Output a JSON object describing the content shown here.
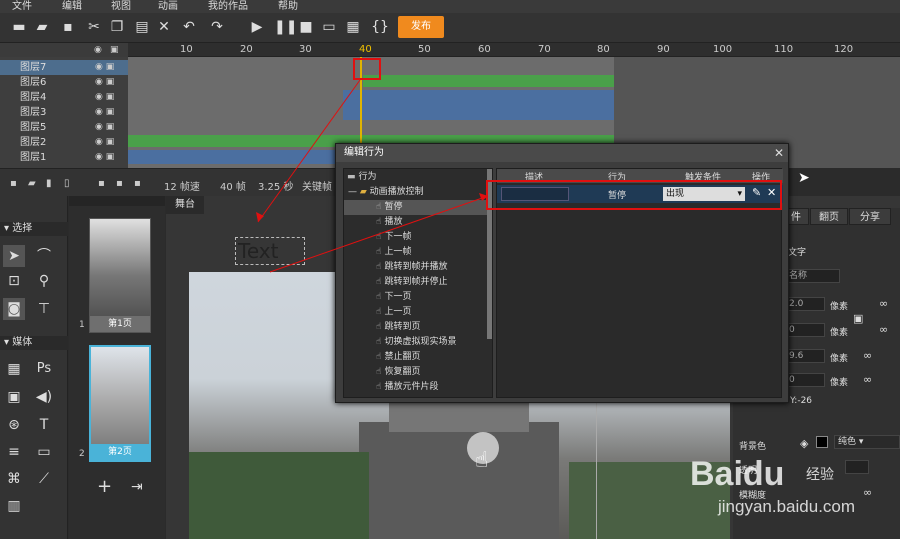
{
  "menu": [
    "文件",
    "编辑",
    "视图",
    "动画",
    "我的作品",
    "帮助"
  ],
  "toolbar": {
    "publish_label": "发布"
  },
  "timeline": {
    "ruler_ticks": [
      "10",
      "20",
      "30",
      "40",
      "50",
      "60",
      "70",
      "80",
      "90",
      "100",
      "110",
      "120"
    ],
    "layers": [
      "图层7",
      "图层6",
      "图层4",
      "图层3",
      "图层5",
      "图层2",
      "图层1"
    ],
    "footer": {
      "fps": "12 帧速",
      "frame": "40 帧",
      "time": "3.25 秒",
      "keyframe": "关键帧分"
    }
  },
  "left_tools": {
    "select_header": "选择",
    "media_header": "媒体"
  },
  "pages": {
    "page1": "第1页",
    "page2": "第2页",
    "num1": "1",
    "num2": "2",
    "add": "+"
  },
  "stage": {
    "tab": "舞台",
    "text_element": "Text"
  },
  "dialog": {
    "title": "编辑行为",
    "tree_root": "行为",
    "tree_folder": "动画播放控制",
    "tree_items": [
      "暂停",
      "播放",
      "下一帧",
      "上一帧",
      "跳转到帧并播放",
      "跳转到帧并停止",
      "下一页",
      "上一页",
      "跳转到页",
      "切换虚拟现实场景",
      "禁止翻页",
      "恢复翻页",
      "播放元件片段"
    ],
    "table_headers": {
      "desc": "描述",
      "behavior": "行为",
      "trigger": "触发条件",
      "ops": "操作"
    },
    "row": {
      "behavior": "暂停",
      "trigger": "出现"
    }
  },
  "right_panel": {
    "tabs": [
      "件",
      "翻页",
      "分享"
    ],
    "label_text": "文字",
    "name_placeholder": "名称",
    "fields": [
      "2.0",
      "0",
      "9.6",
      "0"
    ],
    "unit": "像素",
    "coord": "Y:-26",
    "bg_label": "背景色",
    "bg_value": "纯色",
    "opacity_label": "透明",
    "blur_label": "模糊度"
  },
  "watermark": {
    "brand": "Baidu",
    "site": "jingyan.baidu.com",
    "sub": "经验"
  }
}
